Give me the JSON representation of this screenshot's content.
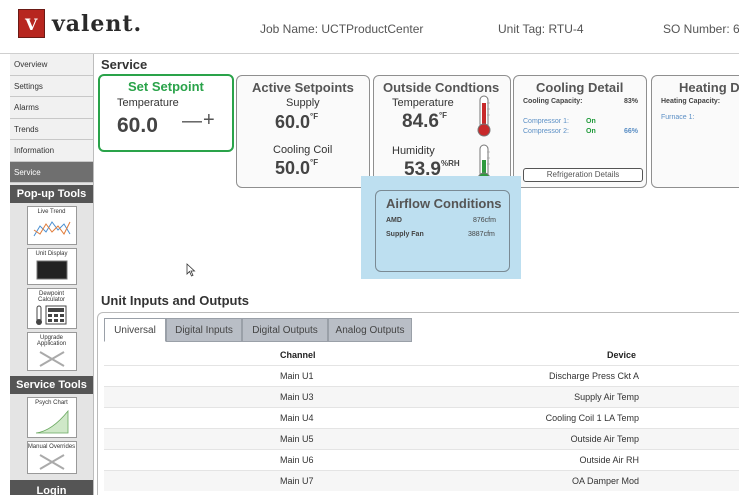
{
  "header": {
    "logo_mark": "V",
    "logo_text": "valent.",
    "job_name": "Job Name: UCTProductCenter",
    "unit_tag": "Unit Tag: RTU-4",
    "so_number": "SO Number: 6"
  },
  "sidebar": {
    "items": [
      {
        "label": "Overview"
      },
      {
        "label": "Settings"
      },
      {
        "label": "Alarms"
      },
      {
        "label": "Trends"
      },
      {
        "label": "Information"
      },
      {
        "label": "Service"
      }
    ],
    "popup_tools_title": "Pop-up Tools",
    "popup_tools": [
      {
        "label": "Live Trend",
        "icon": "live-trend-icon"
      },
      {
        "label": "Unit Display",
        "icon": "unit-display-icon"
      },
      {
        "label": "Dewpoint Calculator",
        "icon": "calculator-icon"
      },
      {
        "label": "Upgrade Application",
        "icon": "tools-icon"
      }
    ],
    "service_tools_title": "Service Tools",
    "service_tools": [
      {
        "label": "Psych Chart",
        "icon": "psych-chart-icon"
      },
      {
        "label": "Manual Overrides",
        "icon": "tools-icon"
      }
    ],
    "login_label": "Login"
  },
  "main": {
    "title": "Service",
    "set_setpoint": {
      "title": "Set Setpoint",
      "label": "Temperature",
      "value": "60.0",
      "minus": "—",
      "plus": "+"
    },
    "active_setpoints": {
      "title": "Active Setpoints",
      "supply_label": "Supply",
      "supply_value": "60.0",
      "supply_unit": "°F",
      "coil_label": "Cooling Coil",
      "coil_value": "50.0",
      "coil_unit": "°F"
    },
    "outside_conditions": {
      "title": "Outside Condtions",
      "temp_label": "Temperature",
      "temp_value": "84.6",
      "temp_unit": "°F",
      "hum_label": "Humidity",
      "hum_value": "53.9",
      "hum_unit": "%RH"
    },
    "cooling_detail": {
      "title": "Cooling Detail",
      "capacity_label": "Cooling Capacity:",
      "capacity_value": "83%",
      "comp1_label": "Compressor 1:",
      "comp1_state": "On",
      "comp2_label": "Compressor 2:",
      "comp2_state": "On",
      "comp2_value": "66%",
      "button_label": "Refrigeration Details"
    },
    "heating_detail": {
      "title": "Heating D",
      "capacity_label": "Heating Capacity:",
      "furnace_label": "Furnace 1:"
    },
    "airflow": {
      "title": "Airflow Conditions",
      "amd_label": "AMD",
      "amd_value": "876cfm",
      "fan_label": "Supply Fan",
      "fan_value": "3887cfm"
    }
  },
  "io": {
    "title": "Unit Inputs and Outputs",
    "tabs": [
      "Universal",
      "Digital Inputs",
      "Digital Outputs",
      "Analog Outputs"
    ],
    "columns": [
      "Channel",
      "Device"
    ],
    "rows": [
      {
        "channel": "Main U1",
        "device": "Discharge Press Ckt A"
      },
      {
        "channel": "Main U3",
        "device": "Supply Air Temp"
      },
      {
        "channel": "Main U4",
        "device": "Cooling Coil 1 LA Temp"
      },
      {
        "channel": "Main U5",
        "device": "Outside Air Temp"
      },
      {
        "channel": "Main U6",
        "device": "Outside Air RH"
      },
      {
        "channel": "Main U7",
        "device": "OA Damper Mod"
      }
    ]
  },
  "colors": {
    "brand_red": "#b7261f",
    "setpoint_green": "#2aa34a",
    "status_green": "#1f9a3a",
    "highlight_blue": "#bddff0",
    "sidebar_dark": "#555555"
  }
}
